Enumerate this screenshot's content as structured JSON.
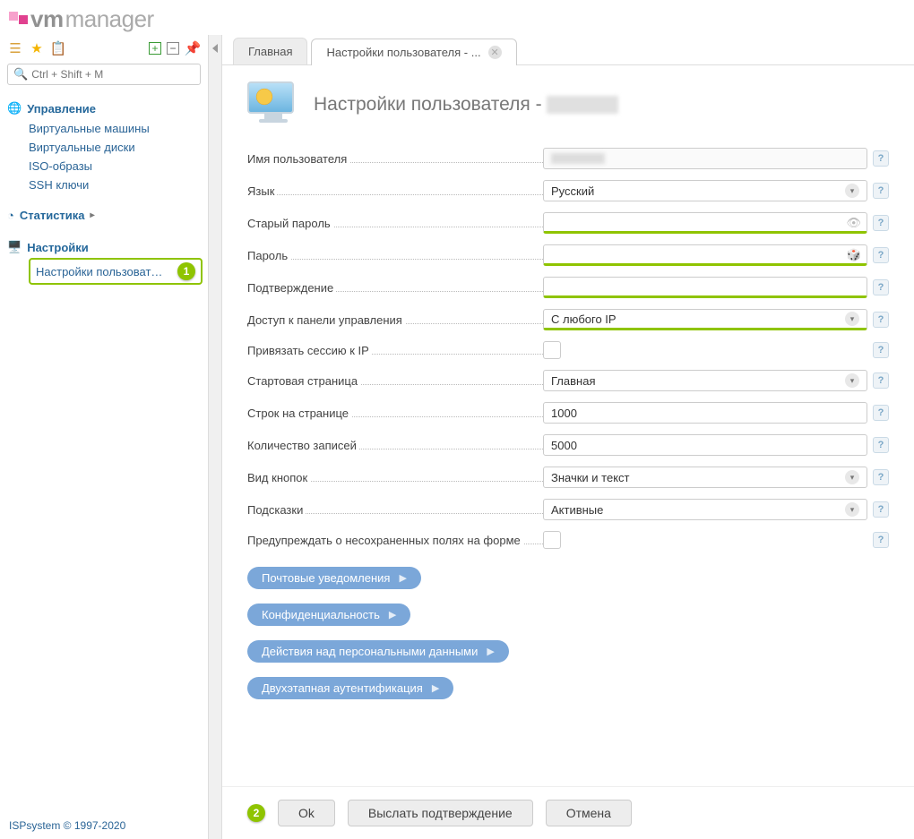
{
  "brand": {
    "bold": "vm",
    "light": "manager"
  },
  "search": {
    "placeholder": "Ctrl + Shift + M"
  },
  "sidebar": {
    "groups": [
      {
        "title": "Управление",
        "items": [
          "Виртуальные машины",
          "Виртуальные диски",
          "ISO-образы",
          "SSH ключи"
        ]
      },
      {
        "title": "Статистика",
        "items": []
      },
      {
        "title": "Настройки",
        "items": [
          "Настройки пользоват…"
        ]
      }
    ],
    "selected_badge": "1"
  },
  "footer": "ISPsystem © 1997-2020",
  "tabs": {
    "main": "Главная",
    "active": "Настройки пользователя - ..."
  },
  "page": {
    "title_prefix": "Настройки пользователя -"
  },
  "form": {
    "username_label": "Имя пользователя",
    "lang_label": "Язык",
    "lang_value": "Русский",
    "oldpw_label": "Старый пароль",
    "pw_label": "Пароль",
    "confirm_label": "Подтверждение",
    "access_label": "Доступ к панели управления",
    "access_value": "С любого IP",
    "bindip_label": "Привязать сессию к IP",
    "startpage_label": "Стартовая страница",
    "startpage_value": "Главная",
    "rows_label": "Строк на странице",
    "rows_value": "1000",
    "records_label": "Количество записей",
    "records_value": "5000",
    "buttons_label": "Вид кнопок",
    "buttons_value": "Значки и текст",
    "hints_label": "Подсказки",
    "hints_value": "Активные",
    "warn_label": "Предупреждать о несохраненных полях на форме"
  },
  "sections": {
    "mail": "Почтовые уведомления",
    "privacy": "Конфиденциальность",
    "personal": "Действия над персональными данными",
    "twofa": "Двухэтапная аутентификация"
  },
  "actions": {
    "badge": "2",
    "ok": "Ok",
    "send": "Выслать подтверждение",
    "cancel": "Отмена"
  }
}
